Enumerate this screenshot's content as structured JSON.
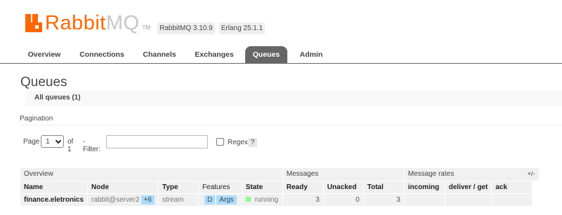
{
  "header": {
    "logo_primary": "Rabbit",
    "logo_secondary": "MQ",
    "logo_tm": "TM",
    "rabbitmq_version": "RabbitMQ 3.10.9",
    "erlang_version": "Erlang 25.1.1"
  },
  "tabs": [
    {
      "label": "Overview",
      "active": false
    },
    {
      "label": "Connections",
      "active": false
    },
    {
      "label": "Channels",
      "active": false
    },
    {
      "label": "Exchanges",
      "active": false
    },
    {
      "label": "Queues",
      "active": true
    },
    {
      "label": "Admin",
      "active": false
    }
  ],
  "page": {
    "title": "Queues",
    "section": "All queues (1)",
    "pagination_label": "Pagination"
  },
  "filter": {
    "page_label": "Page",
    "page_value": "1",
    "of_label": "of 1",
    "filter_label": "- Filter:",
    "filter_value": "",
    "regex_label": "Regex",
    "regex_checked": false,
    "help": "?"
  },
  "table": {
    "groups": {
      "overview": "Overview",
      "messages": "Messages",
      "rates": "Message rates"
    },
    "columns": [
      "Name",
      "Node",
      "Type",
      "Features",
      "State",
      "Ready",
      "Unacked",
      "Total",
      "incoming",
      "deliver / get",
      "ack"
    ],
    "plusminus": "+/-",
    "rows": [
      {
        "name": "finance.eletronics",
        "node": "rabbit@server2",
        "node_extra": "+6",
        "type": "stream",
        "features": [
          "D",
          "Args"
        ],
        "state": "running",
        "ready": "3",
        "unacked": "0",
        "total": "3",
        "incoming": "",
        "deliver_get": "",
        "ack": ""
      }
    ]
  },
  "colors": {
    "brand_orange": "#ff6600",
    "tab_active": "#666666",
    "feature_badge": "#aaddff",
    "state_running": "#88ff88"
  }
}
